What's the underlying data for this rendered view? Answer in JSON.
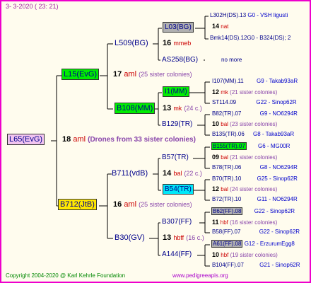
{
  "header": {
    "date": "3-  3-2020 ( 23: 21)"
  },
  "root": {
    "name": "L65(EvG)",
    "num": "18",
    "label": "aml",
    "note": "(Drones from 33 sister colonies)"
  },
  "gen1": {
    "top": {
      "name": "L15(EvG)",
      "num": "17",
      "label": "aml",
      "note": "(25 sister colonies)"
    },
    "bot": {
      "name": "B712(JtB)",
      "num": "16",
      "label": "aml",
      "note": "(25 sister colonies)"
    }
  },
  "gen2": [
    {
      "name": "L509(BG)",
      "num": "16",
      "label": "mmeb",
      "note": ""
    },
    {
      "name": "B108(MM)",
      "num": "13",
      "label": "mk",
      "note": "(24 c.)"
    },
    {
      "name": "B711(vdB)",
      "num": "14",
      "label": "bal",
      "note": "(22 c.)"
    },
    {
      "name": "B30(GV)",
      "num": "13",
      "label": "hbff",
      "note": "(16 c.)"
    }
  ],
  "gen3": [
    {
      "name": "L03(BG)"
    },
    {
      "name": "AS258(BG)"
    },
    {
      "name": "I1(MM)"
    },
    {
      "name": "B129(TR)"
    },
    {
      "name": "B57(TR)"
    },
    {
      "name": "B54(TR)"
    },
    {
      "name": "B307(FF)"
    },
    {
      "name": "A144(FF)"
    }
  ],
  "gen4": [
    {
      "code": "L302H(DS).13",
      "tail": "G0 - VSH ligusti"
    },
    {
      "num": "14",
      "label": "nat"
    },
    {
      "code": "Bmk14(DS).12G0 - B324(DS); 2"
    },
    {
      "note": "no more"
    },
    {
      "code": "I107(MM).11",
      "tail": "G9 - Takab93aR"
    },
    {
      "num": "12",
      "label": "mk",
      "note": "(21 sister colonies)"
    },
    {
      "code": "ST114.09",
      "tail": "G22 - Sinop62R"
    },
    {
      "code": "B82(TR).07",
      "tail": "G9 - NO6294R"
    },
    {
      "num": "10",
      "label": "bal",
      "note": "(23 sister colonies)"
    },
    {
      "code": "B135(TR).06",
      "tail": "G8 - Takab93aR"
    },
    {
      "code": "B155(TR).07",
      "tail": "G6 - MG00R"
    },
    {
      "num": "09",
      "label": "bal",
      "note": "(21 sister colonies)"
    },
    {
      "code": "B78(TR).06",
      "tail": "G8 - NO6294R"
    },
    {
      "code": "B70(TR).10",
      "tail": "G25 - Sinop62R"
    },
    {
      "num": "12",
      "label": "bal",
      "note": "(24 sister colonies)"
    },
    {
      "code": "B72(TR).10",
      "tail": "G11 - NO6294R"
    },
    {
      "code": "B62(FF).08",
      "tail": "G22 - Sinop62R"
    },
    {
      "num": "11",
      "label": "hbf",
      "note": "(16 sister colonies)"
    },
    {
      "code": "B58(FF).07",
      "tail": "G22 - Sinop62R"
    },
    {
      "code": "A61(FF).08",
      "tail": "G12 - ErzurumEgg8"
    },
    {
      "num": "10",
      "label": "hbf",
      "note": "(19 sister colonies)"
    },
    {
      "code": "B104(FF).07",
      "tail": "G21 - Sinop62R"
    }
  ],
  "footer": {
    "copyright": "Copyright 2004-2020 @ Karl Kehrle Foundation",
    "url": "www.pedigreeapis.org"
  },
  "colors": {
    "border": "#ee00cc",
    "bg": "#fffcee",
    "pink": "#f2c4f0",
    "green": "#00ee00",
    "yellow": "#ffe800",
    "gray": "#b0b0b0",
    "cyan": "#00e8f8"
  }
}
